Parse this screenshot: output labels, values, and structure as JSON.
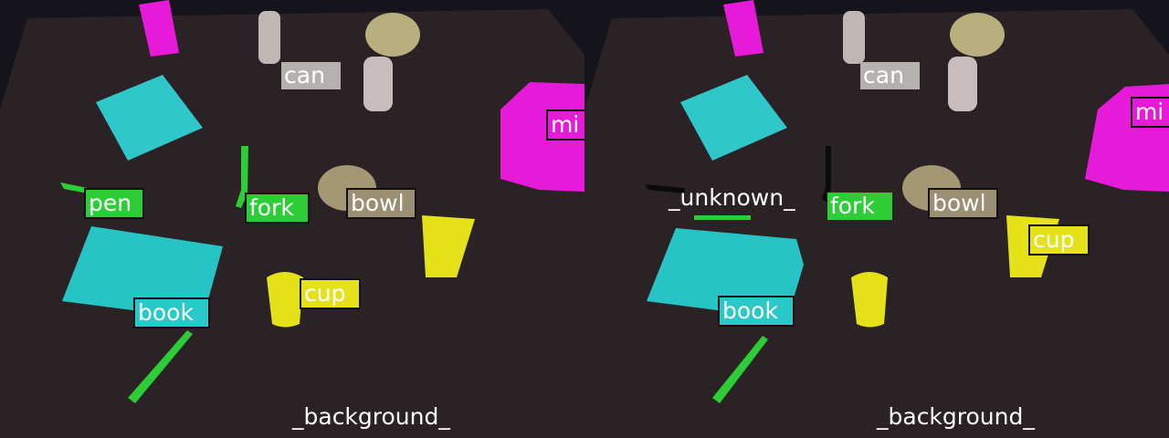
{
  "colors": {
    "can": "#b5b1ae",
    "bowl": "#9a8f72",
    "cup": "#e5e21a",
    "fork": "#2ccd36",
    "pen": "#2ccd36",
    "book": "#29c9c9",
    "milk": "#e81ad9",
    "background_text": "#ffffff"
  },
  "left_panel": {
    "labels": {
      "can": "can",
      "bowl": "bowl",
      "cup": "cup",
      "fork": "fork",
      "pen": "pen",
      "book": "book",
      "milk": "mi",
      "background": "_background_"
    }
  },
  "right_panel": {
    "labels": {
      "can": "can",
      "bowl": "bowl",
      "cup": "cup",
      "fork": "fork",
      "unknown": "_unknown_",
      "book": "book",
      "milk": "mi",
      "background": "_background_"
    }
  }
}
